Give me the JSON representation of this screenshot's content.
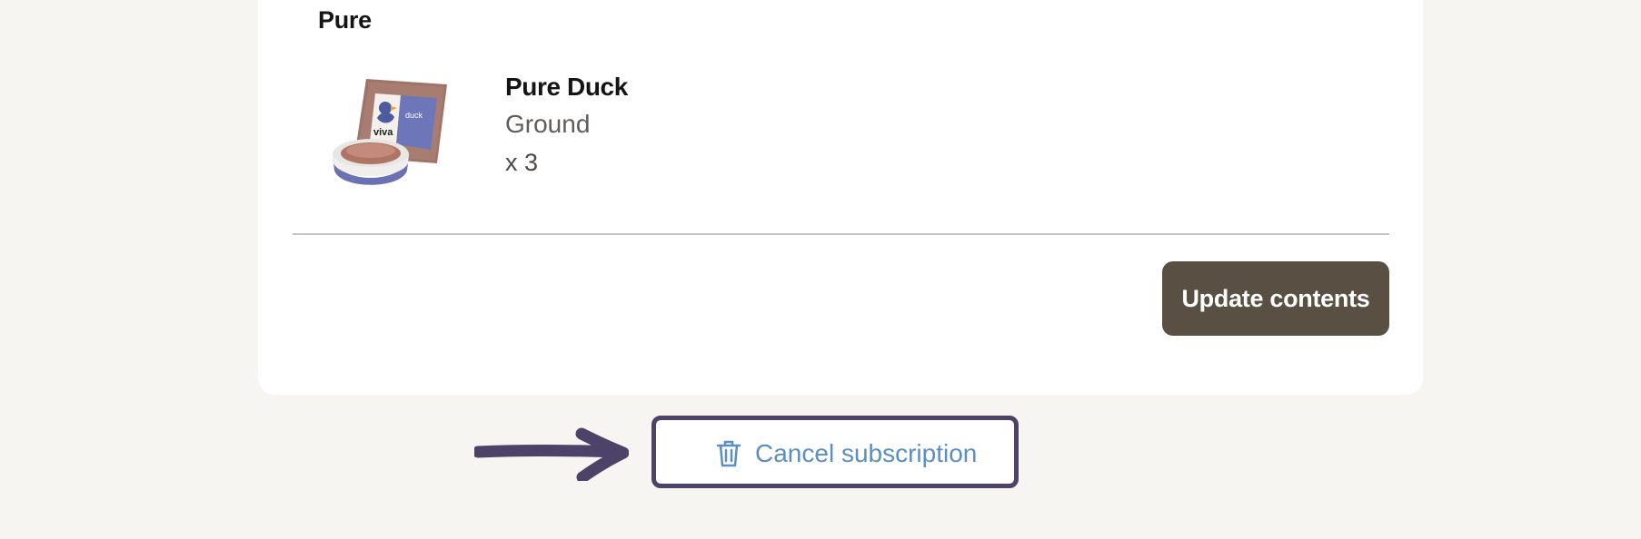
{
  "section": {
    "title": "Pure"
  },
  "product": {
    "name": "Pure Duck",
    "variant": "Ground",
    "quantity": "x 3",
    "image_icon": "duck-food-package-image",
    "package_brand": "viva",
    "package_label": "duck"
  },
  "actions": {
    "update_label": "Update contents",
    "cancel_label": "Cancel subscription",
    "cancel_icon": "trash-icon"
  },
  "annotation": {
    "arrow_icon": "arrow-right-icon",
    "highlight_color": "#4d4268"
  },
  "colors": {
    "update_button": "#594f43",
    "cancel_text": "#5a8fc2",
    "background": "#f7f5f2",
    "card": "#ffffff"
  }
}
